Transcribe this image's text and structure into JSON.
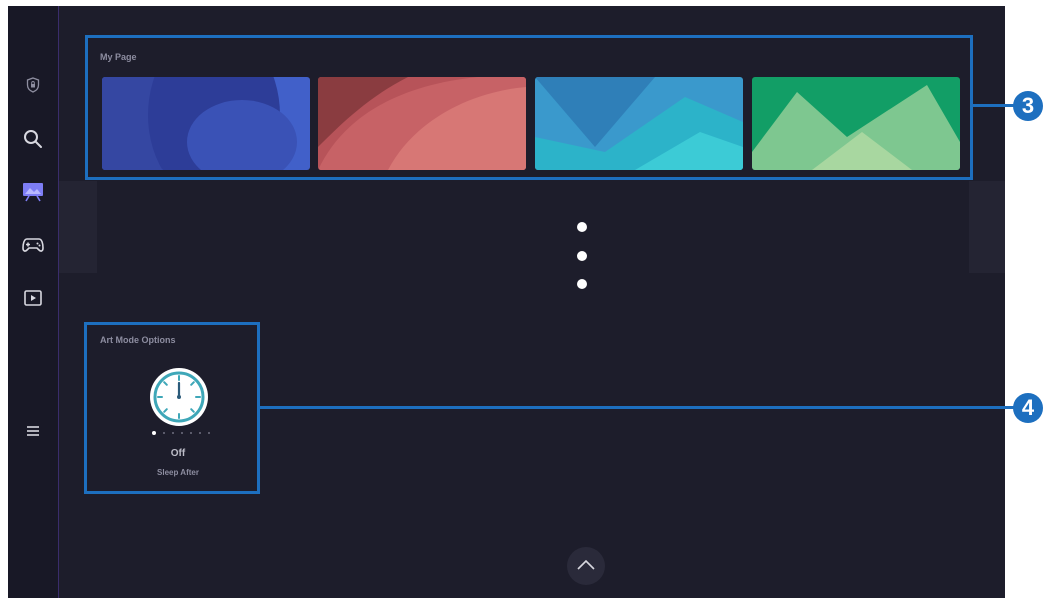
{
  "sidebar": {
    "items": [
      {
        "name": "privacy-shield-icon"
      },
      {
        "name": "search-icon"
      },
      {
        "name": "ambient-art-icon"
      },
      {
        "name": "game-controller-icon"
      },
      {
        "name": "media-play-icon"
      },
      {
        "name": "menu-icon"
      }
    ]
  },
  "my_page": {
    "title": "My Page",
    "thumbnails": [
      "blue-abstract",
      "red-abstract",
      "cyan-abstract",
      "green-abstract"
    ]
  },
  "more_indicator": "vertical-ellipsis",
  "art_mode_options": {
    "title": "Art Mode Options",
    "value": "Off",
    "label": "Sleep After",
    "pager_count": 7,
    "pager_active": 1
  },
  "scroll_up": {
    "icon": "chevron-up-icon"
  },
  "callouts": {
    "first": "3",
    "second": "4"
  },
  "colors": {
    "background": "#1d1d2b",
    "sidebar": "#181826",
    "accent": "#1d6fbf"
  }
}
